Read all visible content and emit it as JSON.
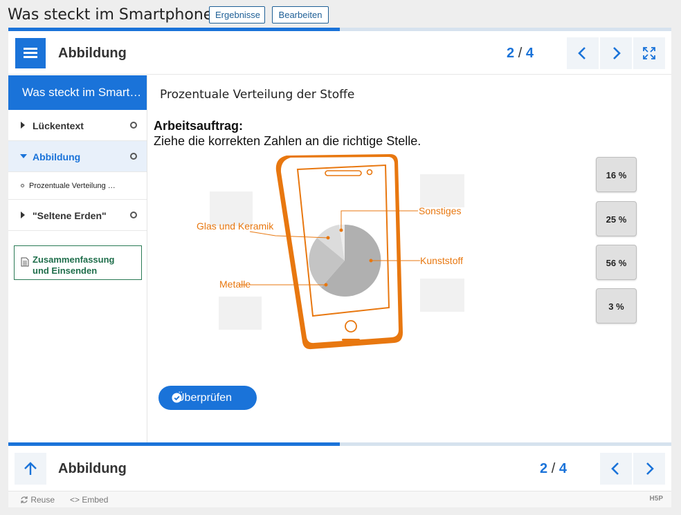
{
  "page": {
    "title": "Was steckt im Smartphone?",
    "results_label": "Ergebnisse",
    "edit_label": "Bearbeiten"
  },
  "header": {
    "title": "Abbildung",
    "current": "2",
    "separator": "/",
    "total": "4"
  },
  "progress": {
    "fraction": 0.5
  },
  "sidebar": {
    "title": "Was steckt im Smartphone?",
    "chapters": [
      {
        "label": "Lückentext",
        "expanded": false
      },
      {
        "label": "Abbildung",
        "expanded": true,
        "sub": "Prozentuale Verteilung der Stoffe"
      },
      {
        "label": "\"Seltene Erden\"",
        "expanded": false
      }
    ],
    "summary_line1": "Zusammenfassung",
    "summary_line2": "und Einsenden"
  },
  "content": {
    "title": "Prozentuale Verteilung der Stoffe",
    "task_heading": "Arbeitsauftrag:",
    "task_text": "Ziehe die korrekten Zahlen an die richtige Stelle.",
    "labels": {
      "glass": "Glas und Keramik",
      "other": "Sonstiges",
      "plastic": "Kunststoff",
      "metal": "Metalle"
    },
    "drag_items": [
      "16 %",
      "25 %",
      "56 %",
      "3 %"
    ],
    "check_label": "Überprüfen",
    "colors": {
      "accent": "#1a73d9",
      "phone": "#e8770f"
    }
  },
  "footer": {
    "title": "Abbildung",
    "current": "2",
    "separator": "/",
    "total": "4",
    "reuse": "Reuse",
    "embed": "Embed",
    "brand": "H5P"
  }
}
